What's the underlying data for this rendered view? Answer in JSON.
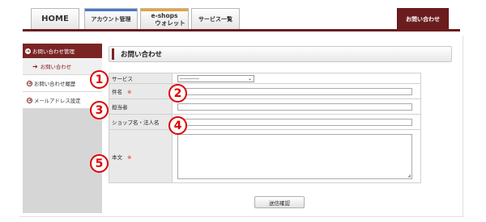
{
  "tabs": {
    "home": "HOME",
    "account": "アカウント管理",
    "eshops_line1": "e-shops",
    "eshops_line2": "ウォレット",
    "service": "サービス一覧",
    "contact": "お問い合わせ"
  },
  "tab_accent_colors": [
    "#4a78c8",
    "#e8a23a"
  ],
  "sidebar": {
    "header": "お問い合わせ管理",
    "items": [
      {
        "label": "お問い合わせ",
        "active": true
      },
      {
        "label": "お問い合わせ履歴",
        "active": false
      },
      {
        "label": "メールアドレス設定",
        "active": false
      }
    ]
  },
  "panel": {
    "title": "お問い合わせ"
  },
  "form": {
    "service_label": "サービス",
    "service_value": "-----------",
    "subject_label": "件名",
    "contact_person_label": "担当者",
    "shop_label": "ショップ名・法人名",
    "body_label": "本文",
    "required_mark": "※"
  },
  "callouts": [
    "1",
    "2",
    "3",
    "4",
    "5"
  ],
  "submit_label": "送信確認",
  "colors": {
    "brand": "#6b1d1d",
    "required": "#dd2222",
    "callout": "#e00000"
  }
}
